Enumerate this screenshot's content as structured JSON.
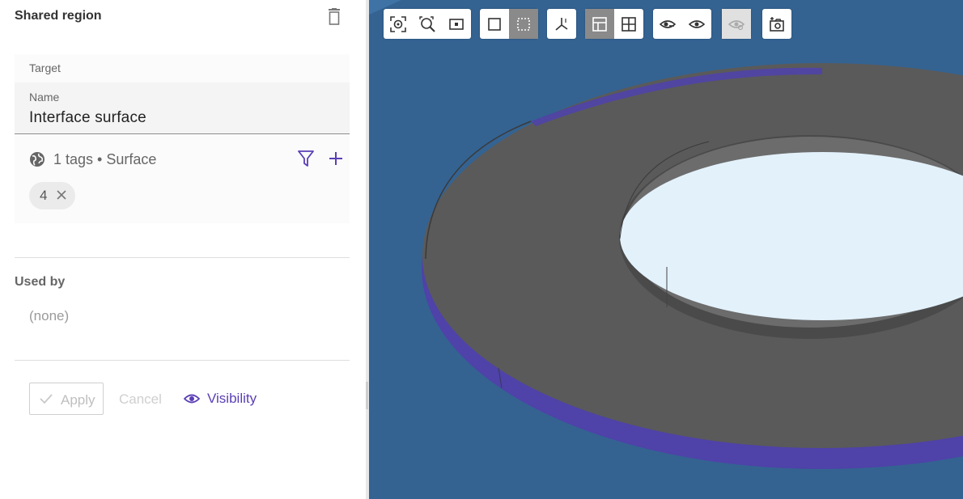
{
  "panel": {
    "title": "Shared region",
    "target_label": "Target",
    "name_label": "Name",
    "name_value": "Interface surface",
    "tags_summary": "1 tags • Surface",
    "chip_value": "4",
    "used_by_title": "Used by",
    "used_by_value": "(none)",
    "apply_label": "Apply",
    "cancel_label": "Cancel",
    "visibility_label": "Visibility"
  },
  "colors": {
    "accent": "#5b3fb5",
    "viewport_bg": "#346392",
    "part_top": "#5a5a5a",
    "part_edge": "#4f42a8",
    "hole": "#e3f1fb"
  },
  "toolbar": {
    "groups": [
      [
        "zoom-to-fit-icon",
        "zoom-selection-icon",
        "zoom-box-icon"
      ],
      [
        "select-single-icon",
        "select-box-icon"
      ],
      [
        "axes-icon"
      ],
      [
        "view-front-icon",
        "view-grid-icon"
      ],
      [
        "hide-icon",
        "show-icon"
      ],
      [
        "show-all-icon"
      ],
      [
        "screenshot-icon"
      ]
    ]
  }
}
